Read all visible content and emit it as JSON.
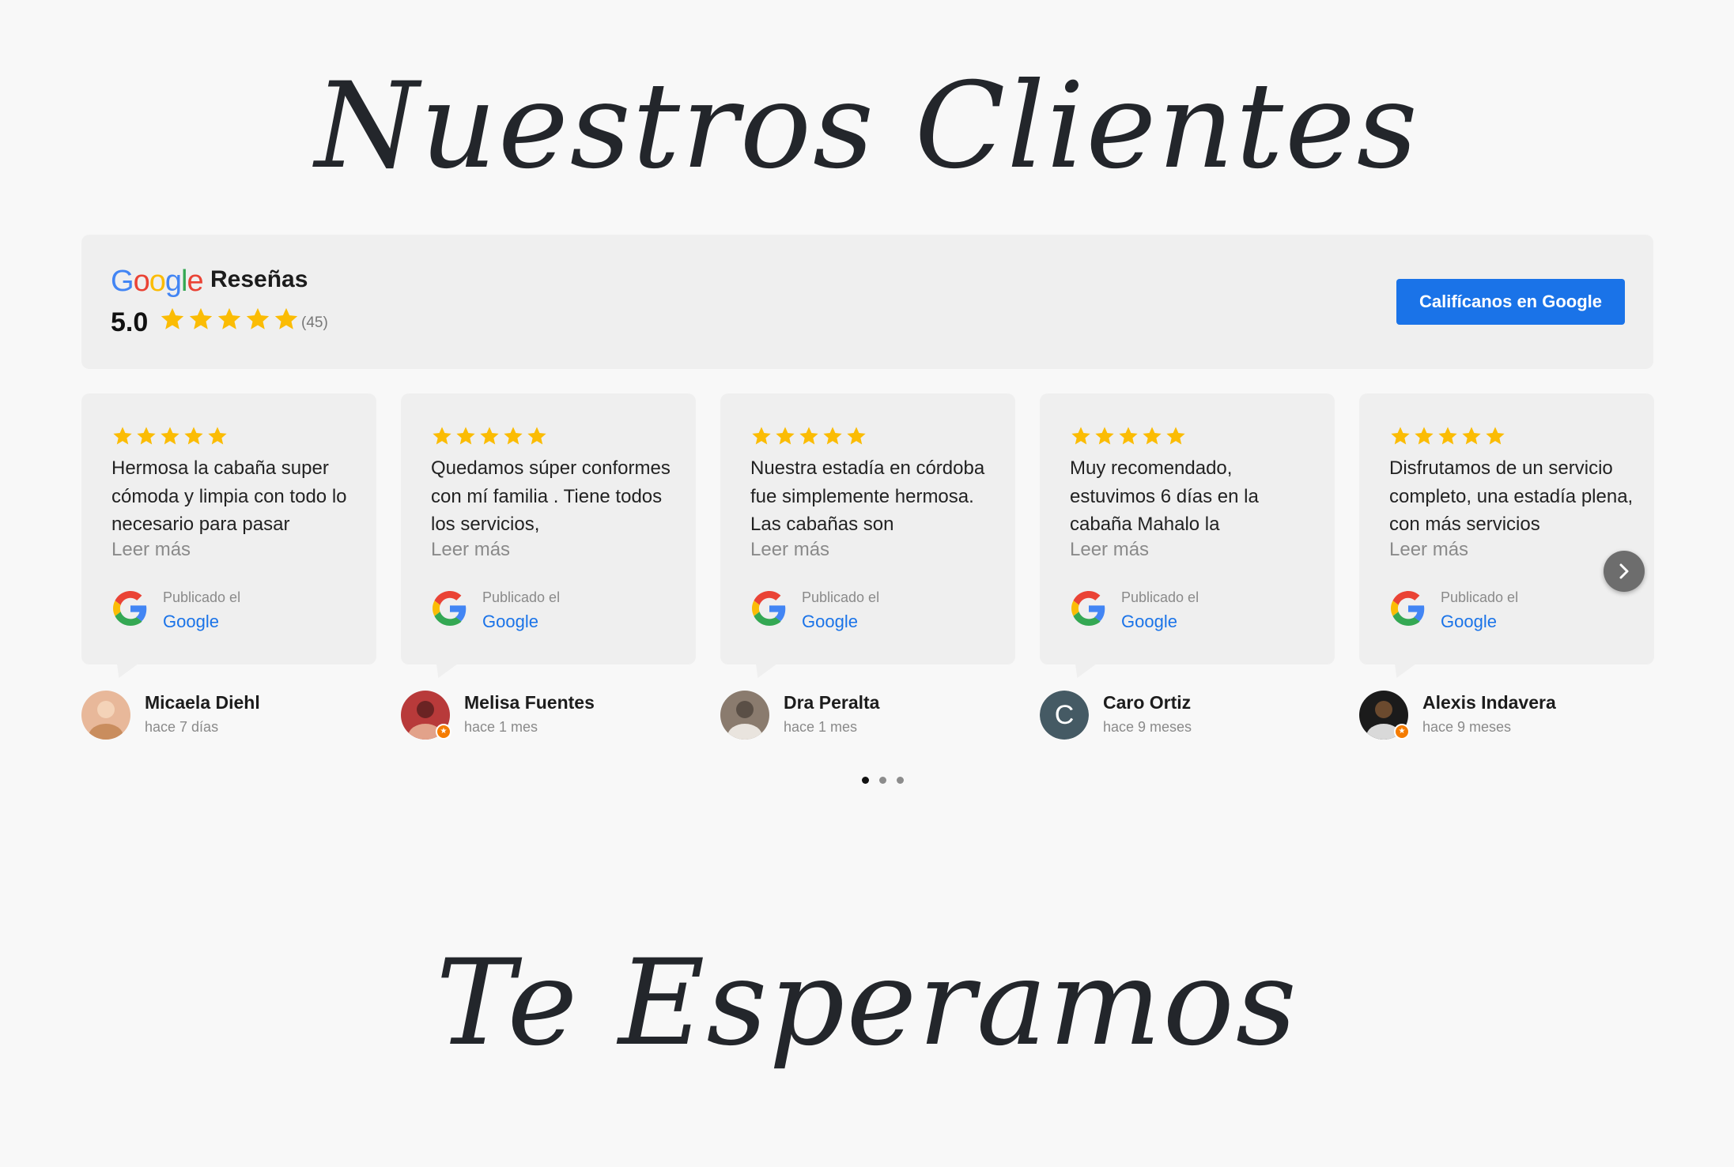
{
  "titles": {
    "top": "Nuestros Clientes",
    "bottom": "Te Esperamos"
  },
  "summary": {
    "logo_text": "Google",
    "title": "Reseñas",
    "rating": "5.0",
    "count": "(45)",
    "rating_stars": 5,
    "button_label": "Califícanos en Google"
  },
  "reviews": [
    {
      "stars": 5,
      "text": "Hermosa la cabaña super cómoda y limpia con todo lo necesario para pasar",
      "more": "Leer más",
      "posted_on": "Publicado el",
      "platform": "Google",
      "author": "Micaela Diehl",
      "date": "hace 7 días",
      "avatar": "photo"
    },
    {
      "stars": 5,
      "text": "Quedamos súper conformes con mí familia . Tiene todos los servicios,",
      "more": "Leer más",
      "posted_on": "Publicado el",
      "platform": "Google",
      "author": "Melisa Fuentes",
      "date": "hace 1 mes",
      "avatar": "photo"
    },
    {
      "stars": 5,
      "text": "Nuestra estadía en córdoba fue simplemente hermosa. Las cabañas son",
      "more": "Leer más",
      "posted_on": "Publicado el",
      "platform": "Google",
      "author": "Dra Peralta",
      "date": "hace 1 mes",
      "avatar": "photo"
    },
    {
      "stars": 5,
      "text": "Muy recomendado, estuvimos 6 días en la cabaña Mahalo la",
      "more": "Leer más",
      "posted_on": "Publicado el",
      "platform": "Google",
      "author": "Caro Ortiz",
      "date": "hace 9 meses",
      "avatar": "letter",
      "avatar_letter": "C"
    },
    {
      "stars": 5,
      "text": "Disfrutamos de un servicio completo, una estadía plena, con más servicios",
      "more": "Leer más",
      "posted_on": "Publicado el",
      "platform": "Google",
      "author": "Alexis Indavera",
      "date": "hace 9 meses",
      "avatar": "photo"
    }
  ],
  "carousel": {
    "pages": 3,
    "active_page": 1
  },
  "colors": {
    "star": "#fbbc04",
    "button": "#1a73e8",
    "link": "#1a73e8"
  },
  "icons": {
    "star": "star-icon",
    "google": "google-g-icon",
    "next": "chevron-right-icon",
    "local_guide": "local-guide-badge-icon"
  }
}
